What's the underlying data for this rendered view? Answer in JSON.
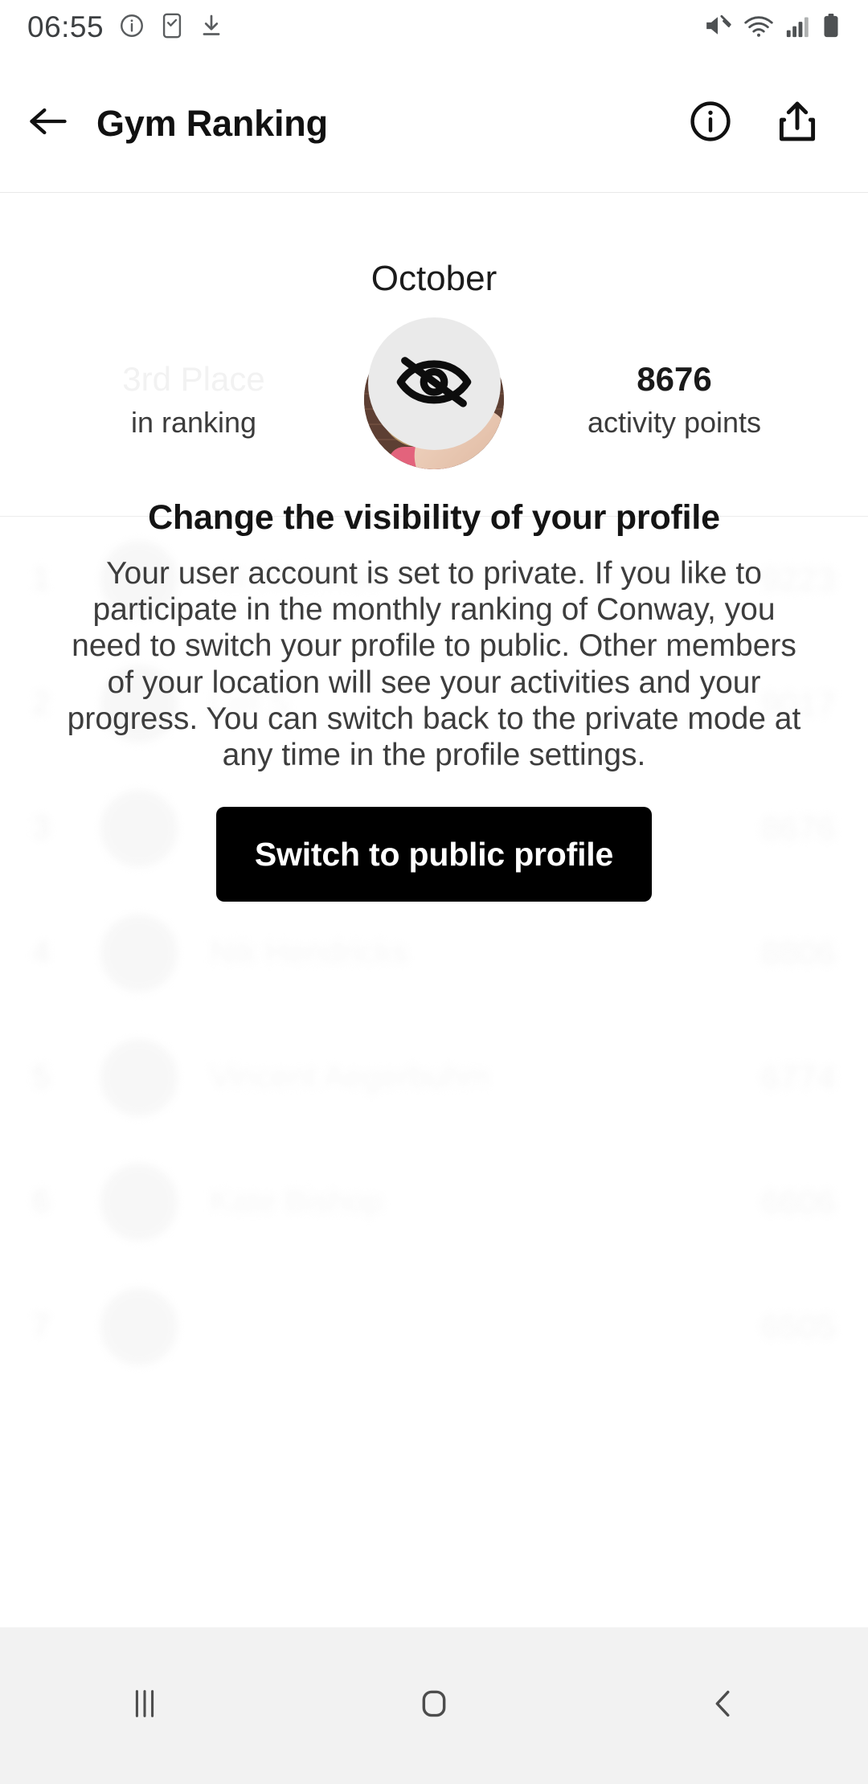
{
  "status_bar": {
    "time": "06:55",
    "left_icons": [
      "info-circle-icon",
      "note-check-icon",
      "download-icon"
    ],
    "right_icons": [
      "mute-icon",
      "wifi-icon",
      "signal-icon",
      "battery-icon"
    ]
  },
  "app_bar": {
    "back_icon": "arrow-left-icon",
    "title": "Gym Ranking",
    "info_icon": "info-circle-icon",
    "share_icon": "share-icon"
  },
  "header_card": {
    "month": "October",
    "rank_value": "3rd Place",
    "rank_label": "in ranking",
    "points_value": "8676",
    "points_label": "activity points"
  },
  "ranking": {
    "rows": [
      {
        "position": "1",
        "name": "Kit Weirmeir",
        "points": "9223"
      },
      {
        "position": "2",
        "name": "Liel S",
        "points": "9017"
      },
      {
        "position": "3",
        "name": "",
        "points": "8676"
      },
      {
        "position": "4",
        "name": "Nik Hendricks",
        "points": "8806"
      },
      {
        "position": "5",
        "name": "Vincent Aegerbuhm",
        "points": "6774"
      },
      {
        "position": "6",
        "name": "Kate Bishop",
        "points": "6606"
      },
      {
        "position": "7",
        "name": "",
        "points": "6505"
      }
    ]
  },
  "overlay": {
    "icon": "eye-off-icon",
    "title": "Change the visibility of your profile",
    "body": "Your user account is set to private. If you like to participate in the monthly ranking of Conway, you need to switch your profile to public. Other members of your location will see your activities and your progress. You can switch back to the private mode at any time in the profile settings.",
    "button_label": "Switch to public profile"
  },
  "nav_bar": {
    "recents_icon": "recents-icon",
    "home_icon": "home-icon",
    "back_icon": "back-chevron-icon"
  },
  "colors": {
    "accent": "#000000",
    "background": "#ffffff",
    "nav_background": "#f2f2f2",
    "icon_circle": "#eaeaea",
    "muted_text": "#3d3d3d"
  }
}
